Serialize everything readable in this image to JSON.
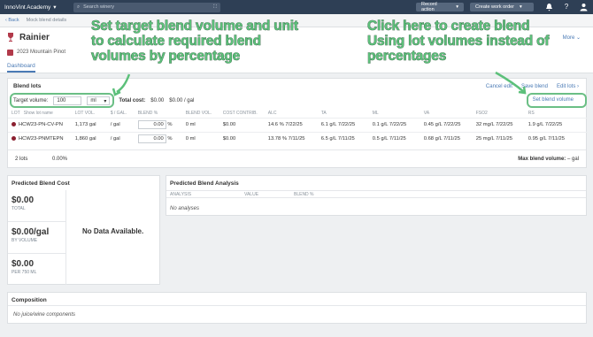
{
  "topbar": {
    "brand": "InnoVint Academy",
    "search_placeholder": "Search winery",
    "record_action": "Record action",
    "create_work_order": "Create work order"
  },
  "breadcrumb": {
    "back": "Back",
    "current": "Mock blend details"
  },
  "header": {
    "title": "Rainier",
    "subtitle": "2023 Mountain Pinot",
    "more": "More",
    "tab": "Dashboard"
  },
  "blend_lots": {
    "title": "Blend lots",
    "links": [
      "Cancel edit",
      "Save blend",
      "Edit lots"
    ],
    "target_volume_label": "Target volume:",
    "target_volume_value": "100",
    "unit": "ml",
    "total_cost_label": "Total cost:",
    "total_cost": "$0.00",
    "cost_per_gal": "$0.00 / gal",
    "set_blend_volume": "Set blend volume",
    "columns": [
      "LOT",
      "Show lot name",
      "LOT VOL.",
      "$ / GAL.",
      "BLEND %",
      "BLEND VOL.",
      "COST CONTRIB.",
      "ALC",
      "TA",
      "ML",
      "VA",
      "FSO2",
      "RS"
    ],
    "rows": [
      {
        "lot": "HCW23-PN-CV-PN",
        "vol": "1,173 gal",
        "per_gal": "/ gal",
        "pct": "0.00",
        "pct_unit": "%",
        "blend_vol": "0 ml",
        "cost": "$0.00",
        "alc": "14.6 % 7/22/25",
        "ta": "6.1 g/L 7/22/25",
        "ml": "0.1 g/L 7/22/25",
        "va": "0.45 g/L 7/22/25",
        "fso2": "32 mg/L 7/22/25",
        "rs": "1.9 g/L 7/22/25"
      },
      {
        "lot": "HCW23-PNMTEPN",
        "vol": "1,860 gal",
        "per_gal": "/ gal",
        "pct": "0.00",
        "pct_unit": "%",
        "blend_vol": "0 ml",
        "cost": "$0.00",
        "alc": "13.78 % 7/11/25",
        "ta": "6.5 g/L 7/11/25",
        "ml": "0.5 g/L 7/11/25",
        "va": "0.68 g/L 7/11/25",
        "fso2": "25 mg/L 7/11/25",
        "rs": "0.95 g/L 7/11/25"
      }
    ],
    "lots_count": "2 lots",
    "total_pct": "0.00%",
    "max_blend_label": "Max blend volume:",
    "max_blend_value": "– gal"
  },
  "cost_panel": {
    "title": "Predicted Blend Cost",
    "total": "$0.00",
    "total_label": "TOTAL",
    "per_gal": "$0.00/gal",
    "per_gal_label": "BY VOLUME",
    "per_750": "$0.00",
    "per_750_label": "PER 750 ML",
    "no_data": "No Data Available."
  },
  "analysis_panel": {
    "title": "Predicted Blend Analysis",
    "columns": [
      "ANALYSIS",
      "VALUE",
      "BLEND %"
    ],
    "empty": "No analyses"
  },
  "composition": {
    "title": "Composition",
    "empty": "No juice/wine components"
  },
  "annotations": {
    "left": "Set target blend volume and unit to calculate required blend volumes by percentage",
    "right": "Click here to create blend Using lot volumes instead of percentages"
  },
  "colors": {
    "topbar": "#2e3f55",
    "accent": "#4a7ab5",
    "annotation": "#5cc07a"
  }
}
